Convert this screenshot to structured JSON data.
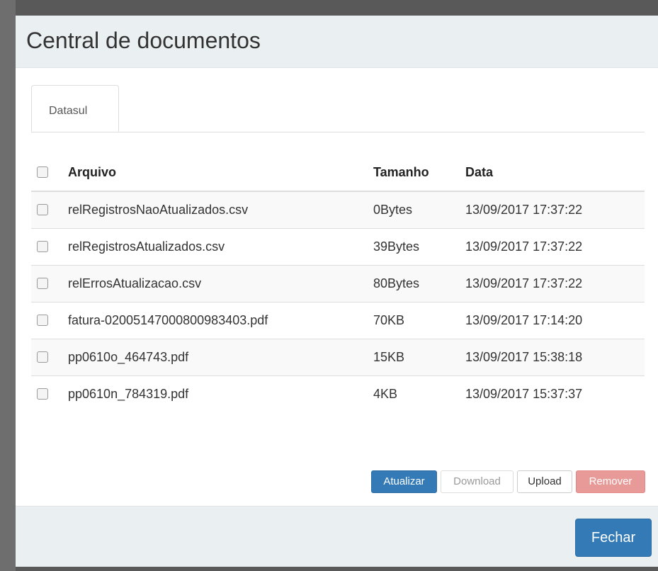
{
  "modal": {
    "title": "Central de documentos",
    "tabs": [
      {
        "label": "Datasul"
      }
    ],
    "table": {
      "headers": {
        "file": "Arquivo",
        "size": "Tamanho",
        "date": "Data"
      },
      "rows": [
        {
          "file": "relRegistrosNaoAtualizados.csv",
          "size": "0Bytes",
          "date": "13/09/2017 17:37:22"
        },
        {
          "file": "relRegistrosAtualizados.csv",
          "size": "39Bytes",
          "date": "13/09/2017 17:37:22"
        },
        {
          "file": "relErrosAtualizacao.csv",
          "size": "80Bytes",
          "date": "13/09/2017 17:37:22"
        },
        {
          "file": "fatura-02005147000800983403.pdf",
          "size": "70KB",
          "date": "13/09/2017 17:14:20"
        },
        {
          "file": "pp0610o_464743.pdf",
          "size": "15KB",
          "date": "13/09/2017 15:38:18"
        },
        {
          "file": "pp0610n_784319.pdf",
          "size": "4KB",
          "date": "13/09/2017 15:37:37"
        }
      ]
    },
    "actions": {
      "refresh": "Atualizar",
      "download": "Download",
      "upload": "Upload",
      "remove": "Remover"
    },
    "footer": {
      "close": "Fechar"
    }
  },
  "colors": {
    "primary": "#337ab7",
    "danger_disabled": "#e89a98",
    "header_bg": "#eaeff1"
  }
}
